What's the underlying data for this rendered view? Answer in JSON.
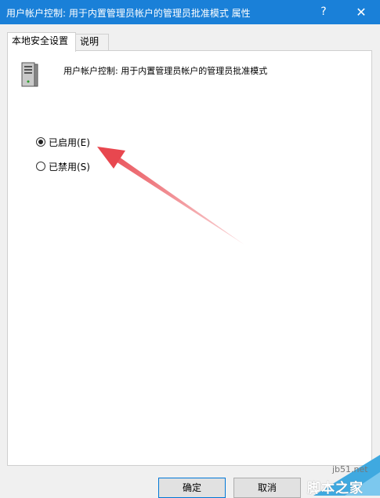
{
  "window": {
    "title": "用户帐户控制: 用于内置管理员帐户的管理员批准模式 属性",
    "help_glyph": "?",
    "close_glyph": "✕"
  },
  "tabs": [
    {
      "label": "本地安全设置",
      "active": true
    },
    {
      "label": "说明",
      "active": false
    }
  ],
  "policy": {
    "name": "用户帐户控制: 用于内置管理员帐户的管理员批准模式",
    "icon": "server-icon"
  },
  "options": [
    {
      "label": "已启用(E)",
      "selected": true
    },
    {
      "label": "已禁用(S)",
      "selected": false
    }
  ],
  "buttons": {
    "ok": "确定",
    "cancel": "取消"
  },
  "annotation": {
    "color": "#e8474f"
  },
  "watermark": {
    "url": "jb51.net",
    "text": "脚本之家"
  }
}
